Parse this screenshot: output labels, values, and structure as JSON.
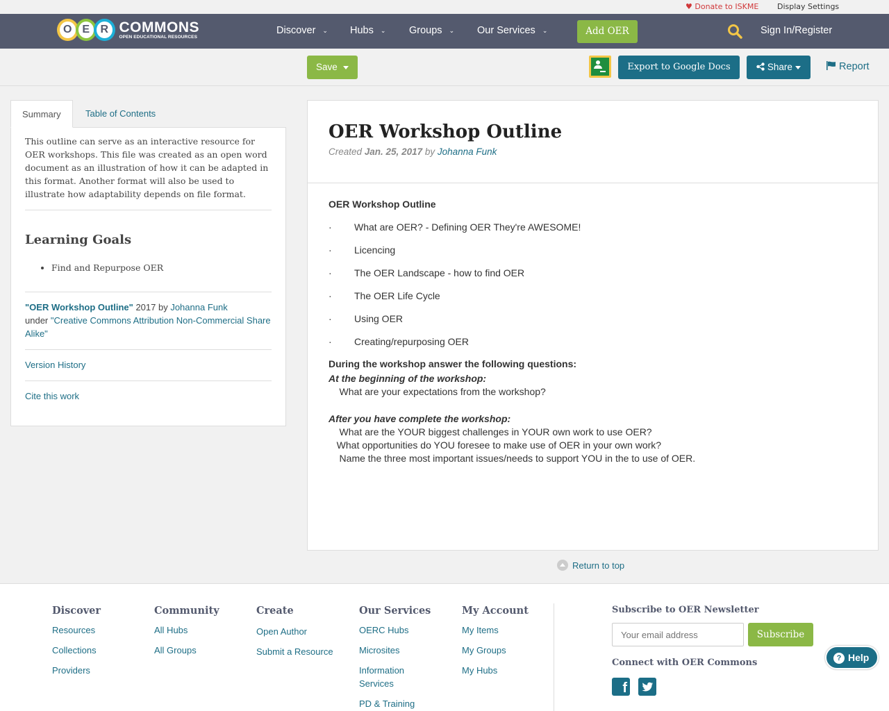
{
  "utility": {
    "donate": "Donate to ISKME",
    "display_settings": "Display Settings"
  },
  "logo": {
    "letters": [
      "O",
      "E",
      "R"
    ],
    "title": "COMMONS",
    "subtitle": "OPEN EDUCATIONAL RESOURCES"
  },
  "nav": {
    "items": [
      {
        "label": "Discover"
      },
      {
        "label": "Hubs"
      },
      {
        "label": "Groups"
      },
      {
        "label": "Our Services"
      }
    ],
    "add_oer": "Add OER",
    "sign_in": "Sign In/Register"
  },
  "toolbar": {
    "save": "Save",
    "export": "Export to Google Docs",
    "share": "Share",
    "report": "Report"
  },
  "sidebar": {
    "tabs": [
      {
        "label": "Summary"
      },
      {
        "label": "Table of Contents"
      }
    ],
    "summary": "This outline can serve as an interactive resource for OER workshops. This file was created as an open word document as an illustration of how it can be adapted in this format. Another format will also be used to illustrate how adaptability depends on file format.",
    "learning_goals_title": "Learning Goals",
    "learning_goals": [
      "Find and Repurpose OER"
    ],
    "attribution": {
      "title": "\"OER Workshop Outline\"",
      "year_by": " 2017 by ",
      "author": "Johanna Funk",
      "under": "under ",
      "license": "\"Creative Commons Attribution Non-Commercial Share Alike\""
    },
    "version_history": "Version History",
    "cite": "Cite this work"
  },
  "content": {
    "title": "OER Workshop Outline",
    "created_label": "Created ",
    "date": "Jan. 25, 2017",
    "by_label": " by ",
    "author": "Johanna Funk",
    "body_heading": "OER Workshop Outline",
    "outline_bullet": "·",
    "outline": [
      "What are OER? - Defining OER They're AWESOME!",
      "Licencing",
      "The OER Landscape - how to find OER",
      "The OER Life Cycle",
      "Using OER",
      "Creating/repurposing  OER"
    ],
    "questions_heading": "During the workshop answer the following questions:",
    "beginning_label": "At the beginning of the workshop:",
    "beginning_q": "    What are your expectations from the workshop?",
    "after_label": "After you have complete the workshop:",
    "after_q1": "    What are the YOUR biggest challenges in YOUR own work to use OER?",
    "after_q2": "   What opportunities do YOU foresee to make use of OER in your own work?",
    "after_q3": "    Name the three most important issues/needs to support YOU in the to use of OER."
  },
  "return_top": "Return to top",
  "footer": {
    "columns": [
      {
        "title": "Discover",
        "links": [
          "Resources",
          "Collections",
          "Providers"
        ]
      },
      {
        "title": "Community",
        "links": [
          "All Hubs",
          "All Groups"
        ]
      },
      {
        "title": "Create",
        "links": [
          "Open Author",
          "Submit a Resource"
        ]
      },
      {
        "title": "Our Services",
        "links": [
          "OERC Hubs",
          "Microsites",
          "Information Services",
          "PD & Training"
        ]
      },
      {
        "title": "My Account",
        "links": [
          "My Items",
          "My Groups",
          "My Hubs"
        ]
      }
    ],
    "newsletter_title": "Subscribe to OER Newsletter",
    "email_placeholder": "Your email address",
    "subscribe": "Subscribe",
    "connect_title": "Connect with OER Commons",
    "facebook_glyph": "f"
  },
  "help": {
    "glyph": "?",
    "label": "Help"
  },
  "colors": {
    "navbar": "#545a6e",
    "accent_green": "#8bb846",
    "accent_teal": "#1c6e87",
    "donate_red": "#d0383a"
  },
  "icons": {
    "donate": "heart-icon",
    "search": "search-icon",
    "share": "share-icon",
    "report": "flag-icon",
    "classroom": "google-classroom-icon",
    "return_top": "chevron-up-circle-icon",
    "facebook": "facebook-icon",
    "twitter": "twitter-icon",
    "help": "question-icon"
  }
}
